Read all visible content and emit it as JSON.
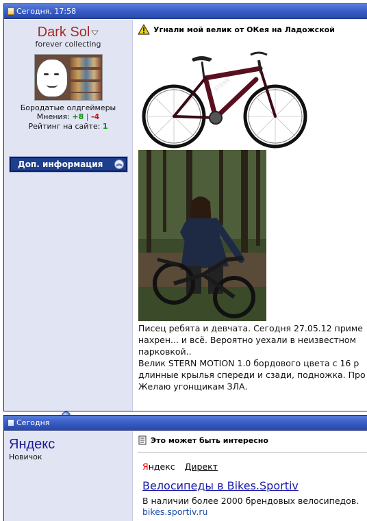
{
  "post1": {
    "date": "Сегодня, 17:58",
    "user": {
      "name": "Dark Sol",
      "title": "forever collecting",
      "group": "Бородатые олдгеймеры",
      "opinions_label": "Мнения:",
      "opinions_pos": "+8",
      "opinions_sep": "|",
      "opinions_neg": "-4",
      "rating_label": "Рейтинг на сайте:",
      "rating_value": "1",
      "more_button": "Доп. информация"
    },
    "title": "Угнали мой велик от ОКея на Ладожской",
    "body_lines": [
      "Писец ребята и девчата. Сегодня 27.05.12 приме",
      "нахрен... и всё. Вероятно уехали в неизвестном",
      "парковкой..",
      "Велик STERN MOTION 1.0 бордового цвета с 16 р",
      "длинные крылья спереди и сзади, подножка. Про",
      "Желаю угонщикам ЗЛА."
    ]
  },
  "post2": {
    "date": "Сегодня",
    "user": {
      "name": "Яндекс",
      "title": "Новичок"
    },
    "title": "Это может быть интересно",
    "ad": {
      "yandex_label_y": "Я",
      "yandex_label_rest": "ндекс",
      "direct_label": "Директ",
      "headline": "Велосипеды в Bikes.Sportiv",
      "description": "В наличии более 2000 брендовых велосипедов.",
      "url": "bikes.sportiv.ru"
    }
  },
  "icons": {
    "post_icon": "post-status-icon",
    "warning": "warning-icon",
    "document": "document-icon",
    "chevron": "chevron-up-icon",
    "online": "online-status-icon"
  }
}
